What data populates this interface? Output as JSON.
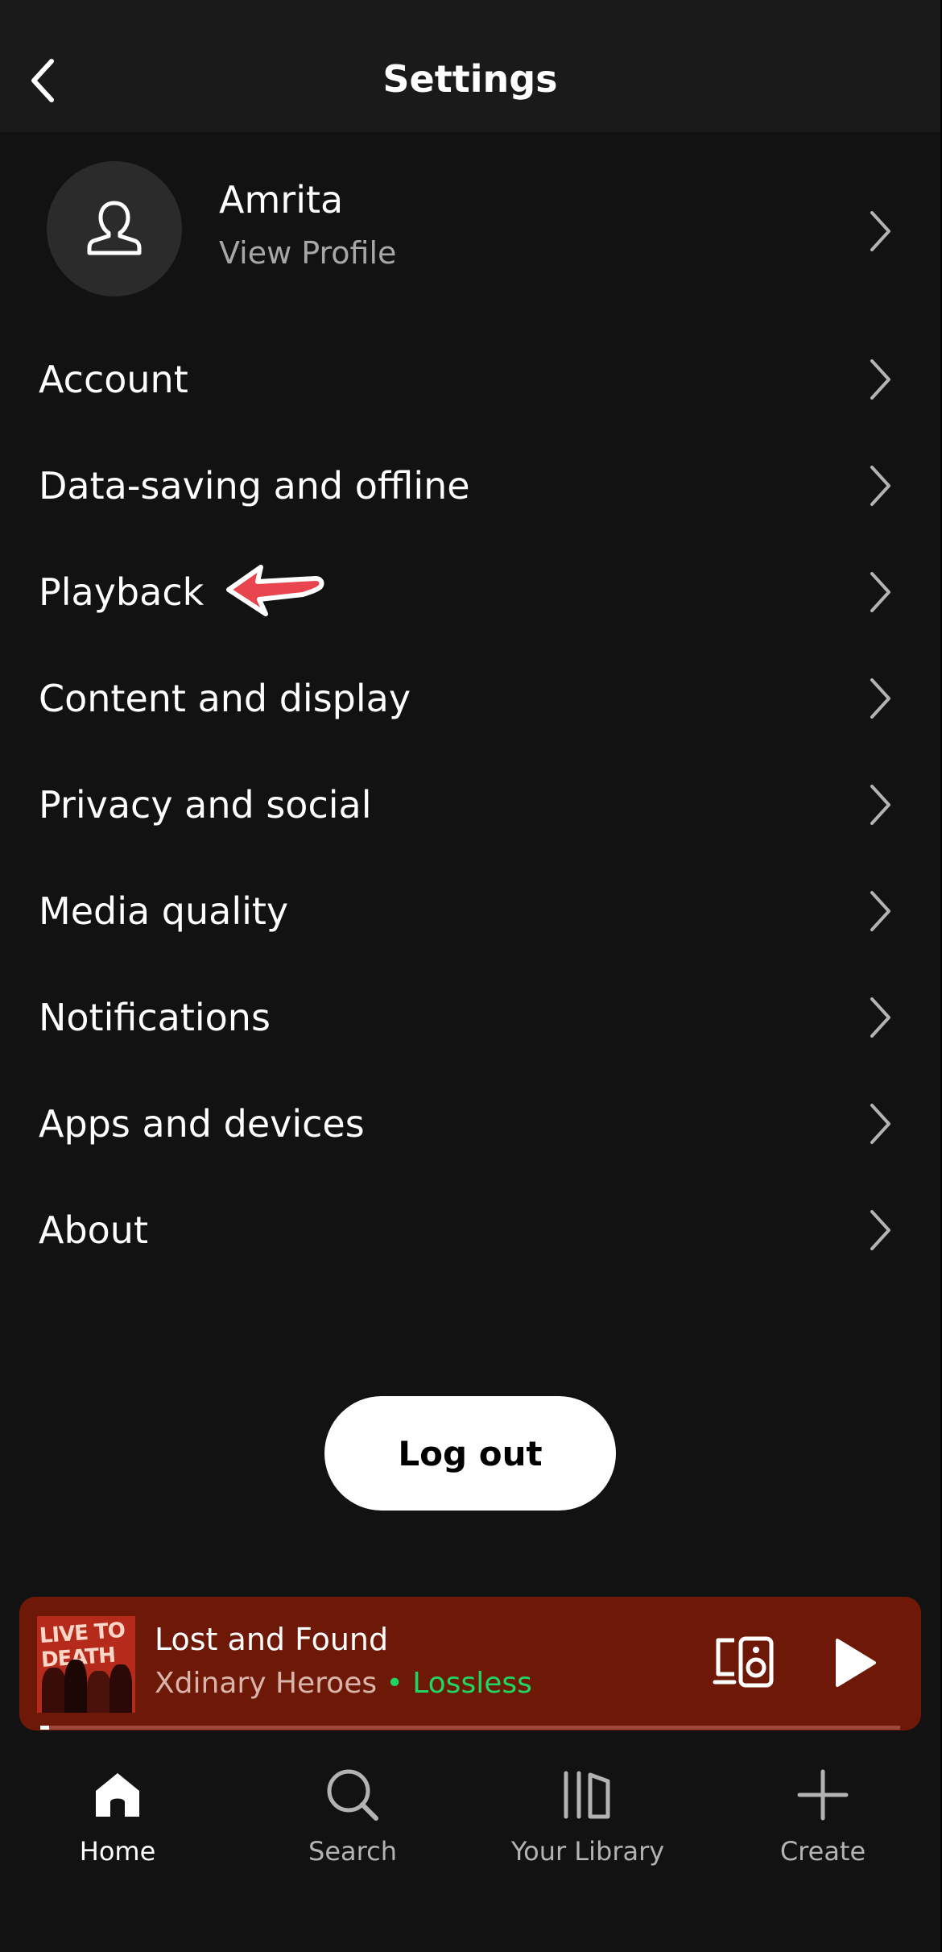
{
  "header": {
    "title": "Settings"
  },
  "profile": {
    "name": "Amrita",
    "subtitle": "View Profile"
  },
  "settings": [
    {
      "label": "Account"
    },
    {
      "label": "Data-saving and offline"
    },
    {
      "label": "Playback"
    },
    {
      "label": "Content and display"
    },
    {
      "label": "Privacy and social"
    },
    {
      "label": "Media quality"
    },
    {
      "label": "Notifications"
    },
    {
      "label": "Apps and devices"
    },
    {
      "label": "About"
    }
  ],
  "logout_label": "Log out",
  "player": {
    "title": "Lost and Found",
    "artist": "Xdinary Heroes",
    "separator": " • ",
    "quality": "Lossless",
    "cover_text": "LIVE TO DEATH",
    "progress": 0.01,
    "background_color": "#6e1807",
    "icons": {
      "device": "connect-device-icon",
      "play": "play-icon"
    }
  },
  "nav": [
    {
      "label": "Home",
      "icon": "home-icon",
      "active": true
    },
    {
      "label": "Search",
      "icon": "search-icon",
      "active": false
    },
    {
      "label": "Your Library",
      "icon": "library-icon",
      "active": false
    },
    {
      "label": "Create",
      "icon": "plus-icon",
      "active": false
    }
  ],
  "colors": {
    "background": "#121212",
    "header": "#1a1a1a",
    "accent": "#1ed760",
    "annotation_arrow": "#e8454f"
  }
}
